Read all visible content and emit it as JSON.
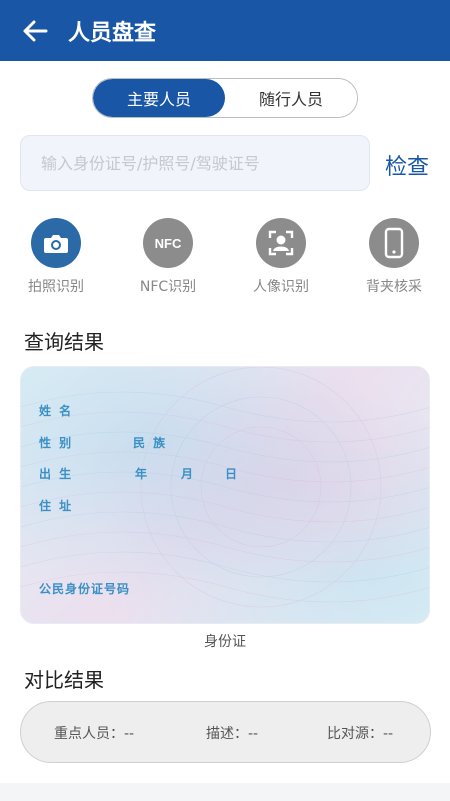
{
  "header": {
    "title": "人员盘查"
  },
  "tabs": [
    {
      "label": "主要人员",
      "active": true
    },
    {
      "label": "随行人员",
      "active": false
    }
  ],
  "search": {
    "placeholder": "输入身份证号/护照号/驾驶证号",
    "value": "",
    "button_label": "检查"
  },
  "tools": [
    {
      "label": "拍照识别",
      "icon": "camera-icon",
      "color": "#2b6aa6"
    },
    {
      "label": "NFC识别",
      "icon": "nfc-icon",
      "color": "#8c8c8c",
      "icon_text": "NFC"
    },
    {
      "label": "人像识别",
      "icon": "face-scan-icon",
      "color": "#8c8c8c"
    },
    {
      "label": "背夹核采",
      "icon": "phone-icon",
      "color": "#8c8c8c"
    }
  ],
  "query_result": {
    "title": "查询结果",
    "card": {
      "name_label": "姓 名",
      "sex_label": "性 别",
      "ethnicity_label": "民 族",
      "birth_label": "出 生",
      "year_label": "年",
      "month_label": "月",
      "day_label": "日",
      "address_label": "住 址",
      "id_number_label": "公民身份证号码"
    },
    "caption": "身份证"
  },
  "compare_result": {
    "title": "对比结果",
    "key_person": "重点人员：--",
    "description": "描述：--",
    "source": "比对源：--"
  },
  "colors": {
    "primary": "#1a56a6",
    "card_text": "#3a8fc4"
  }
}
